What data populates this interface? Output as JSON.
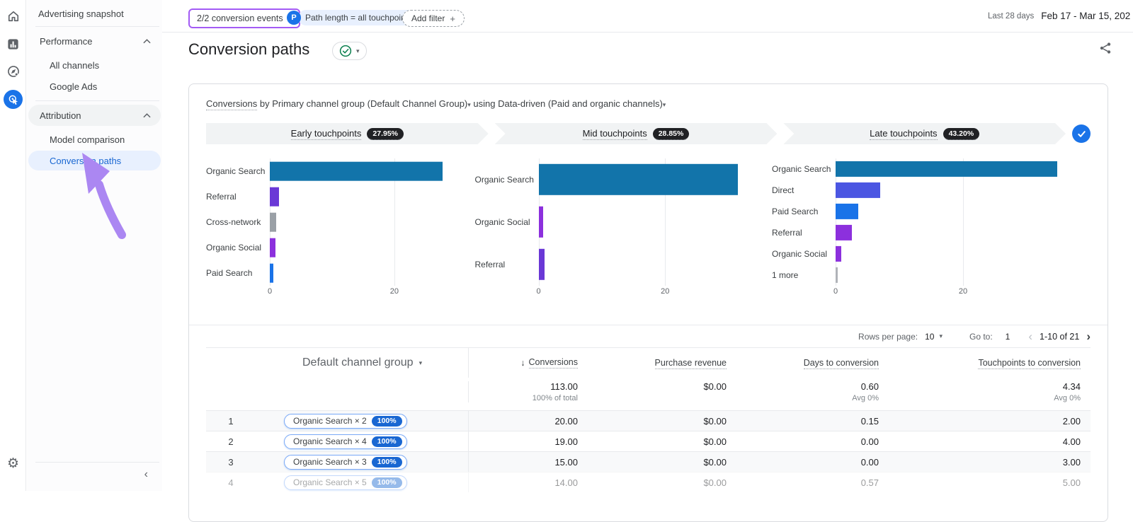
{
  "sidebar": {
    "snapshot": "Advertising snapshot",
    "sections": [
      {
        "label": "Performance",
        "items": [
          {
            "label": "All channels"
          },
          {
            "label": "Google Ads"
          }
        ]
      },
      {
        "label": "Attribution",
        "items": [
          {
            "label": "Model comparison"
          },
          {
            "label": "Conversion paths"
          }
        ]
      }
    ]
  },
  "topbar": {
    "conversion_events_button": "2/2 conversion events",
    "caret": "▾",
    "path_filter_badge": "P",
    "path_filter_chip": "Path length = all touchpoin...",
    "add_filter_label": "Add filter",
    "plus": "+",
    "date_preset": "Last 28 days",
    "date_range": "Feb 17 - Mar 15, 202"
  },
  "page": {
    "title": "Conversion paths"
  },
  "report_header": {
    "metric": "Conversions",
    "dimension_text": " by Primary channel group (Default Channel Group)",
    "using_word": " using ",
    "model_text": "Data-driven (Paid and organic channels)",
    "caret": "▾"
  },
  "funnel": {
    "stages": [
      {
        "label": "Early touchpoints",
        "pct": "27.95%"
      },
      {
        "label": "Mid touchpoints",
        "pct": "28.85%"
      },
      {
        "label": "Late touchpoints",
        "pct": "43.20%"
      }
    ]
  },
  "chart_data": [
    {
      "type": "bar",
      "orientation": "horizontal",
      "title": "Early touchpoints",
      "share_pct": "27.95%",
      "categories": [
        "Organic Search",
        "Referral",
        "Cross-network",
        "Organic Social",
        "Paid Search"
      ],
      "values": [
        27.8,
        1.5,
        1.0,
        0.9,
        0.6
      ],
      "bar_colors": [
        "#1274aa",
        "#6a38d6",
        "#9aa0a6",
        "#8c30dd",
        "#1a73e8"
      ],
      "xticks": [
        0,
        20
      ],
      "xmax": 29,
      "xlabel": "",
      "ylabel": ""
    },
    {
      "type": "bar",
      "orientation": "horizontal",
      "title": "Mid touchpoints",
      "share_pct": "28.85%",
      "categories": [
        "Organic Search",
        "Organic Social",
        "Referral"
      ],
      "values": [
        31.5,
        0.7,
        0.9
      ],
      "bar_colors": [
        "#1274aa",
        "#8c30dd",
        "#6a38d6"
      ],
      "xticks": [
        0,
        20
      ],
      "xmax": 33,
      "xlabel": "",
      "ylabel": ""
    },
    {
      "type": "bar",
      "orientation": "horizontal",
      "title": "Late touchpoints",
      "share_pct": "43.20%",
      "categories": [
        "Organic Search",
        "Direct",
        "Paid Search",
        "Referral",
        "Organic Social",
        "1 more"
      ],
      "values": [
        34.8,
        7.0,
        3.5,
        2.6,
        0.9,
        0.3
      ],
      "bar_colors": [
        "#1274aa",
        "#4b56e2",
        "#1a73e8",
        "#8c30dd",
        "#8c30dd",
        "#b0b3b8"
      ],
      "xticks": [
        0,
        20
      ],
      "xmax": 40,
      "xlabel": "",
      "ylabel": ""
    }
  ],
  "pagination": {
    "rows_per_page_label": "Rows per page:",
    "rows_per_page": "10",
    "caret": "▾",
    "goto_label": "Go to:",
    "goto_value": "1",
    "prev": "‹",
    "range": "1-10 of 21",
    "next": "›"
  },
  "table": {
    "dimension_header": "Default channel group",
    "dimension_caret": "▾",
    "sort_icon": "↓",
    "columns": [
      "Conversions",
      "Purchase revenue",
      "Days to conversion",
      "Touchpoints to conversion"
    ],
    "totals": {
      "conversions": "113.00",
      "conversions_sub": "100% of total",
      "revenue": "$0.00",
      "days": "0.60",
      "days_sub": "Avg 0%",
      "touchpoints": "4.34",
      "touchpoints_sub": "Avg 0%"
    },
    "rows": [
      {
        "index": "1",
        "path": "Organic Search × 2",
        "attribution_pct": "100%",
        "conversions": "20.00",
        "revenue": "$0.00",
        "days": "0.15",
        "touchpoints": "2.00",
        "faded": false
      },
      {
        "index": "2",
        "path": "Organic Search × 4",
        "attribution_pct": "100%",
        "conversions": "19.00",
        "revenue": "$0.00",
        "days": "0.00",
        "touchpoints": "4.00",
        "faded": false
      },
      {
        "index": "3",
        "path": "Organic Search × 3",
        "attribution_pct": "100%",
        "conversions": "15.00",
        "revenue": "$0.00",
        "days": "0.00",
        "touchpoints": "3.00",
        "faded": false
      },
      {
        "index": "4",
        "path": "Organic Search × 5",
        "attribution_pct": "100%",
        "conversions": "14.00",
        "revenue": "$0.00",
        "days": "0.57",
        "touchpoints": "5.00",
        "faded": true
      }
    ]
  },
  "colors": {
    "accent_blue": "#1a73e8",
    "selected_nav_bg": "#e8f0fe",
    "selected_nav_text": "#1967d2",
    "highlight_purple": "#a35bf5",
    "arrow_purple": "#ab87f2",
    "organic_search_bar": "#1274aa",
    "referral_bar": "#6a38d6",
    "organic_social_bar": "#8c30dd",
    "cross_network_bar": "#9aa0a6",
    "paid_search_bar": "#1a73e8",
    "direct_bar": "#4b56e2"
  }
}
